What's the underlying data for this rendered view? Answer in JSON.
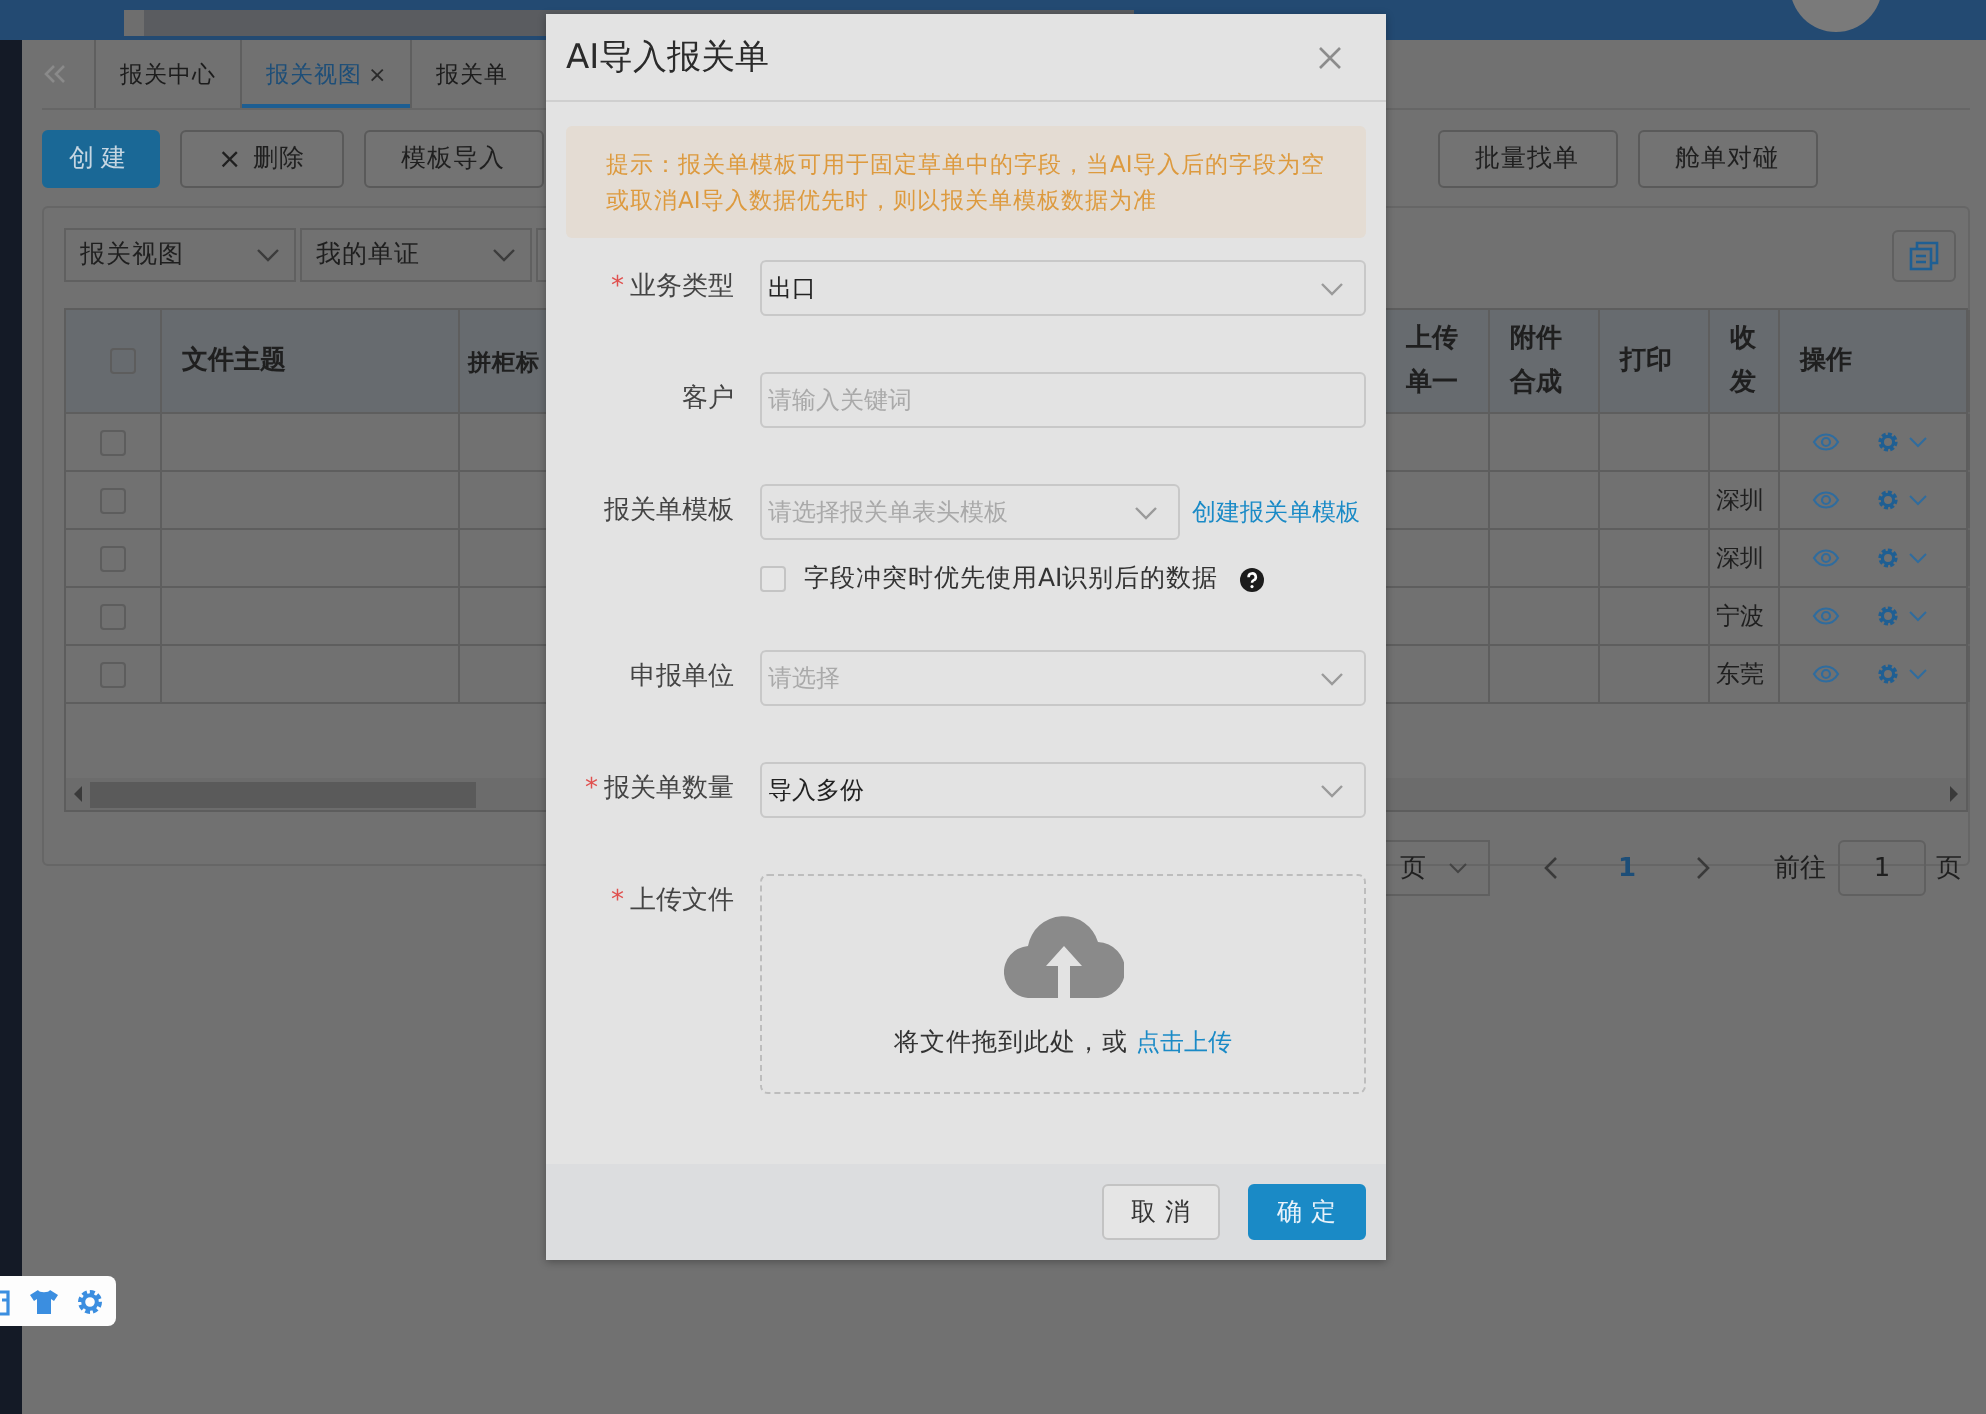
{
  "tabs": [
    {
      "label": "报关中心",
      "selected": false
    },
    {
      "label": "报关视图",
      "selected": true,
      "close": "×"
    },
    {
      "label": "报关单",
      "selected": false
    }
  ],
  "toolbar": [
    {
      "label": "创建",
      "kind": "primary"
    },
    {
      "label": "删除",
      "kind": "default",
      "icon": "×"
    },
    {
      "label": "模板导入",
      "kind": "default"
    },
    {
      "label": "批量找单",
      "kind": "default"
    },
    {
      "label": "舱单对碰",
      "kind": "default"
    }
  ],
  "filters": [
    {
      "value": "报关视图"
    },
    {
      "value": "我的单证"
    }
  ],
  "table": {
    "header_checked": false,
    "columns": [
      {
        "label": "文件主题"
      },
      {
        "label": "拼柜标"
      },
      {
        "label": "上传单一"
      },
      {
        "label": "附件合成"
      },
      {
        "label": "打印"
      },
      {
        "label": "收发"
      },
      {
        "label": "操作"
      }
    ],
    "rows": [
      {
        "checked": false
      },
      {
        "checked": false,
        "dispatch": "深圳"
      },
      {
        "checked": false,
        "dispatch": "深圳"
      },
      {
        "checked": false,
        "dispatch": "宁波"
      },
      {
        "checked": false,
        "dispatch": "东莞"
      }
    ]
  },
  "pagination": {
    "page_size": "页",
    "current": "1",
    "goto_label": "前往",
    "goto_value": "1",
    "goto_suffix": "页"
  },
  "dialog": {
    "title": "AI导入报关单",
    "alert": "提示：报关单模板可用于固定草单中的字段，当AI导入后的字段为空或取消AI导入数据优先时，则以报关单模板数据为准",
    "fields": [
      {
        "label": "业务类型",
        "required_mark": "*",
        "kind": "select",
        "value": "出口"
      },
      {
        "label": "客户",
        "kind": "input",
        "placeholder": "请输入关键词"
      },
      {
        "label": "报关单模板",
        "kind": "select",
        "placeholder": "请选择报关单表头模板",
        "link": "创建报关单模板",
        "option": {
          "label": "字段冲突时优先使用AI识别后的数据",
          "checked": false
        }
      },
      {
        "label": "申报单位",
        "kind": "select",
        "placeholder": "请选择"
      },
      {
        "label": "报关单数量",
        "required_mark": "*",
        "kind": "select",
        "value": "导入多份"
      },
      {
        "label": "上传文件",
        "required_mark": "*",
        "kind": "upload",
        "hint": "将文件拖到此处，或",
        "link": "点击上传"
      }
    ],
    "buttons": [
      {
        "label": "取 消",
        "kind": "default"
      },
      {
        "label": "确 定",
        "kind": "primary"
      }
    ]
  }
}
